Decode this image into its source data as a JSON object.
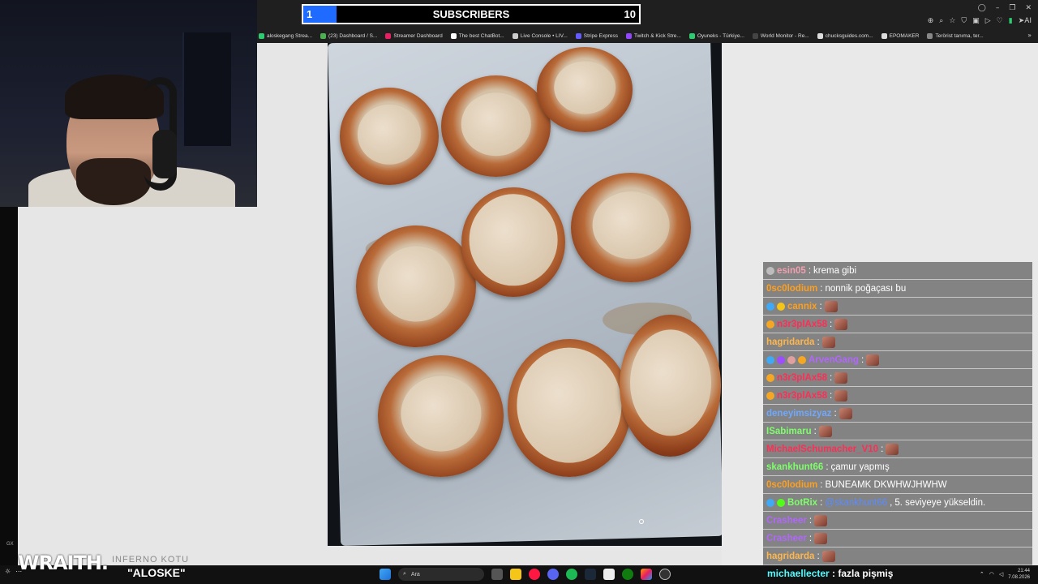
{
  "subscribers": {
    "current": "1",
    "label": "SUBSCRIBERS",
    "goal": "10",
    "progress_fraction": 0.1,
    "fill_color": "#1f6bff"
  },
  "bookmarks": [
    {
      "label": "aloskegang Strea...",
      "color": "#2ecc71"
    },
    {
      "label": "(23) Dashboard / S...",
      "color": "#4caf50"
    },
    {
      "label": "Streamer Dashboard",
      "color": "#e91e63"
    },
    {
      "label": "The best ChatBot...",
      "color": "#ffffff"
    },
    {
      "label": "Live Console • LIV...",
      "color": "#cccccc"
    },
    {
      "label": "Stripe Express",
      "color": "#635bff"
    },
    {
      "label": "Twitch & Kick Stre...",
      "color": "#9146ff"
    },
    {
      "label": "Oyuneks - Türkiye...",
      "color": "#2ecc71"
    },
    {
      "label": "World Monitor - Re...",
      "color": "#444444"
    },
    {
      "label": "chucksguides.com...",
      "color": "#dddddd"
    },
    {
      "label": "EPOMAKER",
      "color": "#dddddd"
    },
    {
      "label": "Terörist tanıma, ter...",
      "color": "#888888"
    }
  ],
  "toolbar": {
    "ai_label": "AI"
  },
  "overlay": {
    "brand": "WRAITH.",
    "brand_sub": "INFERNO KOTU",
    "song": "\"ALOSKE\"",
    "side_badge": "GX"
  },
  "chat": {
    "messages": [
      {
        "badges": [
          "#bdbdbd"
        ],
        "user": "esin05",
        "user_color": "#f0a0b0",
        "text": "krema gibi",
        "emote": false
      },
      {
        "badges": [],
        "user": "0sc0lodium",
        "user_color": "#ff9f1c",
        "text": "nonnik poğaçası bu",
        "emote": false
      },
      {
        "badges": [
          "#3fa9f5",
          "#f5c518"
        ],
        "user": "cannix",
        "user_color": "#ff9f1c",
        "text": "",
        "emote": true
      },
      {
        "badges": [
          "#f5a623"
        ],
        "user": "n3r3plAx58",
        "user_color": "#ff2d55",
        "text": "",
        "emote": true
      },
      {
        "badges": [],
        "user": "hagridarda",
        "user_color": "#ffb74d",
        "text": "",
        "emote": true
      },
      {
        "badges": [
          "#3fa9f5",
          "#9c4dff",
          "#e0a0a0",
          "#f5a623"
        ],
        "user": "ArvenGang",
        "user_color": "#b266ff",
        "text": "",
        "emote": true
      },
      {
        "badges": [
          "#f5a623"
        ],
        "user": "n3r3plAx58",
        "user_color": "#ff2d55",
        "text": "",
        "emote": true
      },
      {
        "badges": [
          "#f5a623"
        ],
        "user": "n3r3plAx58",
        "user_color": "#ff2d55",
        "text": "",
        "emote": true
      },
      {
        "badges": [],
        "user": "deneyimsizyaz",
        "user_color": "#6fa8ff",
        "text": "",
        "emote": true
      },
      {
        "badges": [],
        "user": "ISabimaru",
        "user_color": "#7dff6a",
        "text": "",
        "emote": true
      },
      {
        "badges": [],
        "user": "MichaelSchumacher_V10",
        "user_color": "#ff2d55",
        "text": "",
        "emote": true
      },
      {
        "badges": [],
        "user": "skankhunt66",
        "user_color": "#7dff6a",
        "text": "çamur yapmış",
        "emote": false
      },
      {
        "badges": [],
        "user": "0sc0lodium",
        "user_color": "#ff9f1c",
        "text": "BUNEAMK DKWHWJHWHW",
        "emote": false
      },
      {
        "badges": [
          "#3fa9f5",
          "#53fc18"
        ],
        "user": "BotRix",
        "user_color": "#7dff6a",
        "mention": "@skankhunt66",
        "text": "5. seviyeye yükseldin.",
        "emote": false
      },
      {
        "badges": [],
        "user": "Crasheer",
        "user_color": "#b266ff",
        "text": "",
        "emote": true
      },
      {
        "badges": [],
        "user": "Crasheer",
        "user_color": "#b266ff",
        "text": "",
        "emote": true
      },
      {
        "badges": [],
        "user": "hagridarda",
        "user_color": "#ffb74d",
        "text": "",
        "emote": true
      }
    ],
    "last": {
      "user": "michaellecter",
      "user_color": "#53fcff",
      "text": "fazla pişmiş"
    }
  },
  "taskbar": {
    "search_placeholder": "Ara",
    "time": "21:44",
    "date": "7.08.2026"
  }
}
